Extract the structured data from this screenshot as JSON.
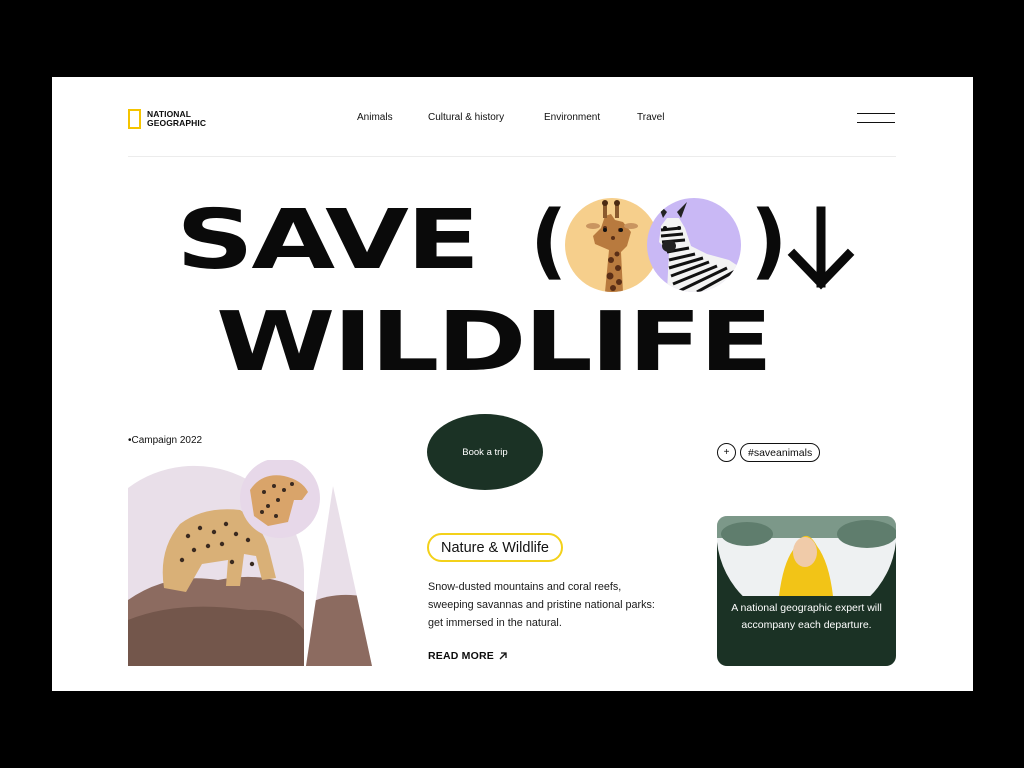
{
  "brand": {
    "line1": "NATIONAL",
    "line2": "GEOGRAPHIC",
    "accent": "#f5c400"
  },
  "nav": [
    "Animals",
    "Cultural & history",
    "Environment",
    "Travel"
  ],
  "menu_icon": "hamburger-icon",
  "hero": {
    "line1": "SAVE",
    "open_paren": "(",
    "close_paren": ")",
    "line2": "WILDLIFE"
  },
  "campaign": "•Campaign 2022",
  "book_button": "Book a trip",
  "plus_icon": "+",
  "hashtag": "#saveanimals",
  "section": {
    "title": "Nature & Wildlife",
    "description": "Snow-dusted mountains and coral reefs, sweeping savannas and pristine national parks: get immersed in the natural.",
    "read_more": "READ MORE"
  },
  "expert_card": {
    "text": "A national geographic expert will accompany each departure."
  },
  "colors": {
    "dark_green": "#1b3225",
    "yellow": "#f3d11a",
    "peach": "#f6cf8c",
    "lavender": "#c9b8f5"
  }
}
